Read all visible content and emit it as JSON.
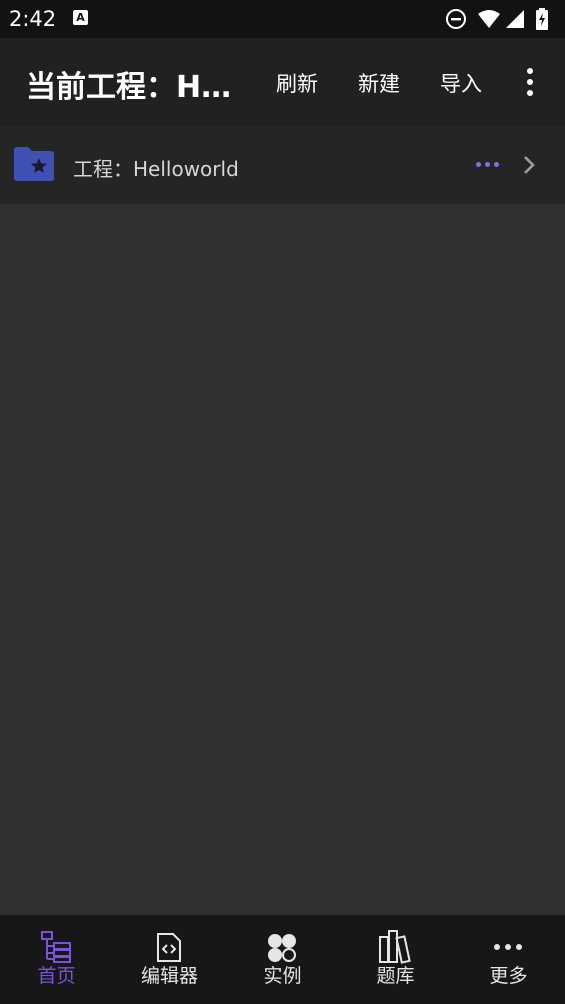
{
  "status_bar": {
    "time": "2:42",
    "notification_icon": "A"
  },
  "app_bar": {
    "title": "当前工程：Helloworld",
    "actions": [
      "刷新",
      "新建",
      "导入"
    ],
    "overflow_icon": "more-vertical-icon"
  },
  "project_list": [
    {
      "label": "工程：Helloworld",
      "icon": "folder-star-icon",
      "more_icon": "more-horizontal-icon",
      "chevron_icon": "chevron-right-icon"
    }
  ],
  "bottom_nav": {
    "items": [
      {
        "label": "首页",
        "icon": "tree-icon",
        "active": true
      },
      {
        "label": "编辑器",
        "icon": "code-file-icon",
        "active": false
      },
      {
        "label": "实例",
        "icon": "grid-icon",
        "active": false
      },
      {
        "label": "题库",
        "icon": "books-icon",
        "active": false
      },
      {
        "label": "更多",
        "icon": "more-horizontal-icon",
        "active": false
      }
    ]
  },
  "colors": {
    "accent": "#7a52e0",
    "folder": "#3f51b5",
    "background": "#303030",
    "app_bar": "#212121"
  }
}
